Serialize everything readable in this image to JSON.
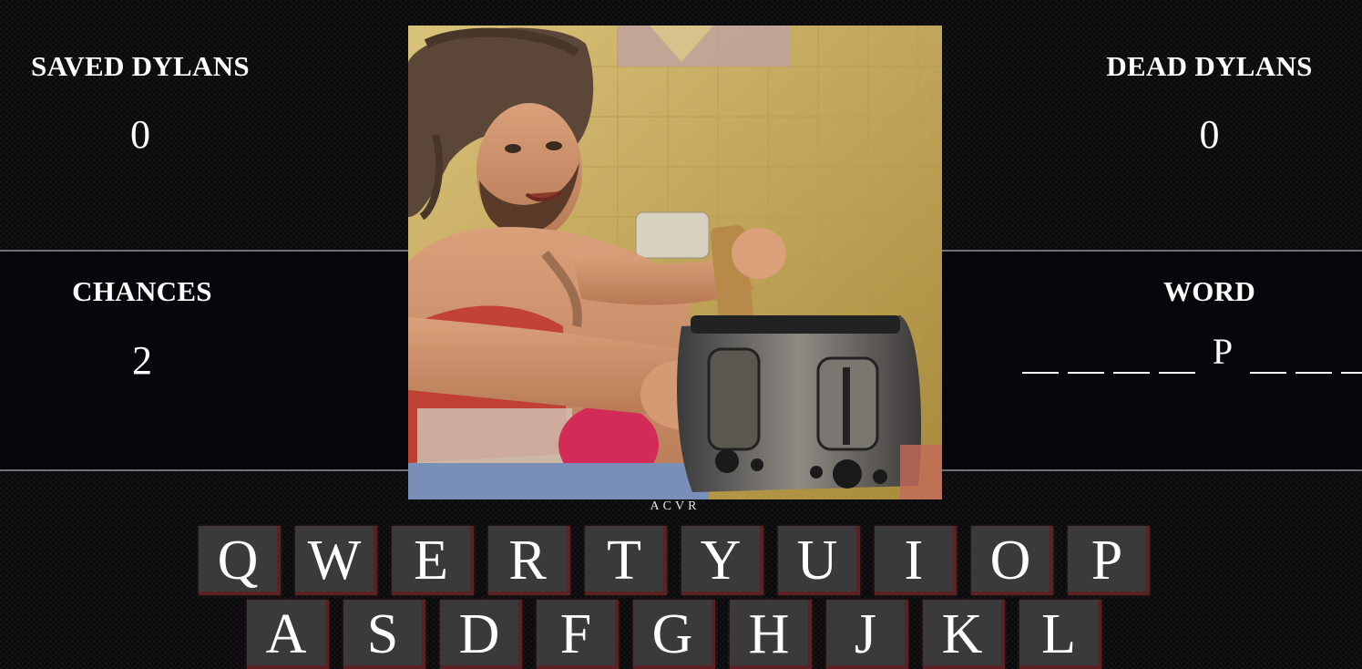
{
  "stats": {
    "saved_label": "SAVED DYLANS",
    "saved_value": "0",
    "dead_label": "DEAD DYLANS",
    "dead_value": "0",
    "chances_label": "CHANCES",
    "chances_value": "2",
    "word_label": "WORD"
  },
  "word": {
    "slots": [
      "",
      "",
      "",
      "",
      "P",
      "",
      "",
      ""
    ]
  },
  "photo": {
    "credit": "ACVR"
  },
  "keyboard": {
    "row1": [
      "Q",
      "W",
      "E",
      "R",
      "T",
      "Y",
      "U",
      "I",
      "O",
      "P"
    ],
    "row2": [
      "A",
      "S",
      "D",
      "F",
      "G",
      "H",
      "J",
      "K",
      "L"
    ]
  },
  "colors": {
    "background": "#0b0b0d",
    "panel": "#07070b",
    "key_face": "#3a3a3c",
    "key_edge": "#5a2222",
    "divider": "#6f6f6f"
  }
}
